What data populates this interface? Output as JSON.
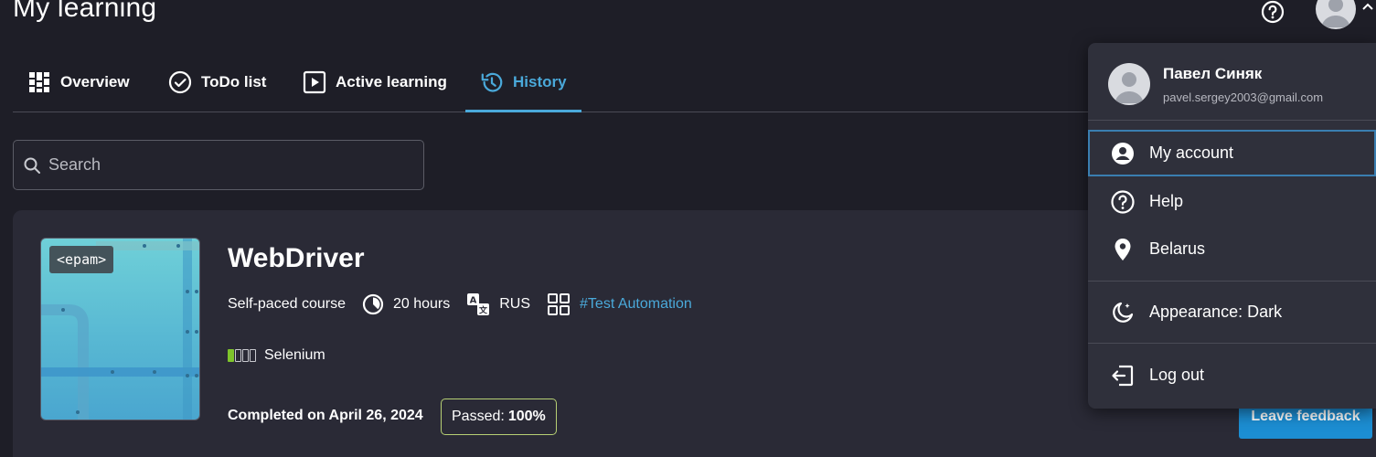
{
  "page": {
    "title": "My learning"
  },
  "tabs": [
    {
      "label": "Overview",
      "icon": "grid-icon"
    },
    {
      "label": "ToDo list",
      "icon": "check-circle-icon"
    },
    {
      "label": "Active learning",
      "icon": "play-square-icon"
    },
    {
      "label": "History",
      "icon": "history-icon",
      "active": true
    }
  ],
  "search": {
    "placeholder": "Search",
    "value": ""
  },
  "course": {
    "badge": "<epam>",
    "title": "WebDriver",
    "type": "Self-paced course",
    "duration": "20 hours",
    "language": "RUS",
    "tag": "#Test Automation",
    "skill": {
      "name": "Selenium",
      "level": 1,
      "max_level": 4
    },
    "completed": "Completed on April 26, 2024",
    "passed_label": "Passed:",
    "passed_value": "100%",
    "feedback_label": "Leave feedback"
  },
  "user_menu": {
    "name": "Павел Синяк",
    "email": "pavel.sergey2003@gmail.com",
    "items": [
      {
        "label": "My account",
        "icon": "account-circle-icon"
      },
      {
        "label": "Help",
        "icon": "help-circle-icon"
      },
      {
        "label": "Belarus",
        "icon": "location-pin-icon"
      },
      {
        "label": "Appearance: Dark",
        "icon": "moon-icon"
      },
      {
        "label": "Log out",
        "icon": "logout-icon"
      }
    ]
  },
  "colors": {
    "background": "#1e1e27",
    "accent": "#4aa9da",
    "button": "#1c8ed3",
    "skill_bar": "#7ec42b",
    "passed_border": "#b6cf74"
  }
}
